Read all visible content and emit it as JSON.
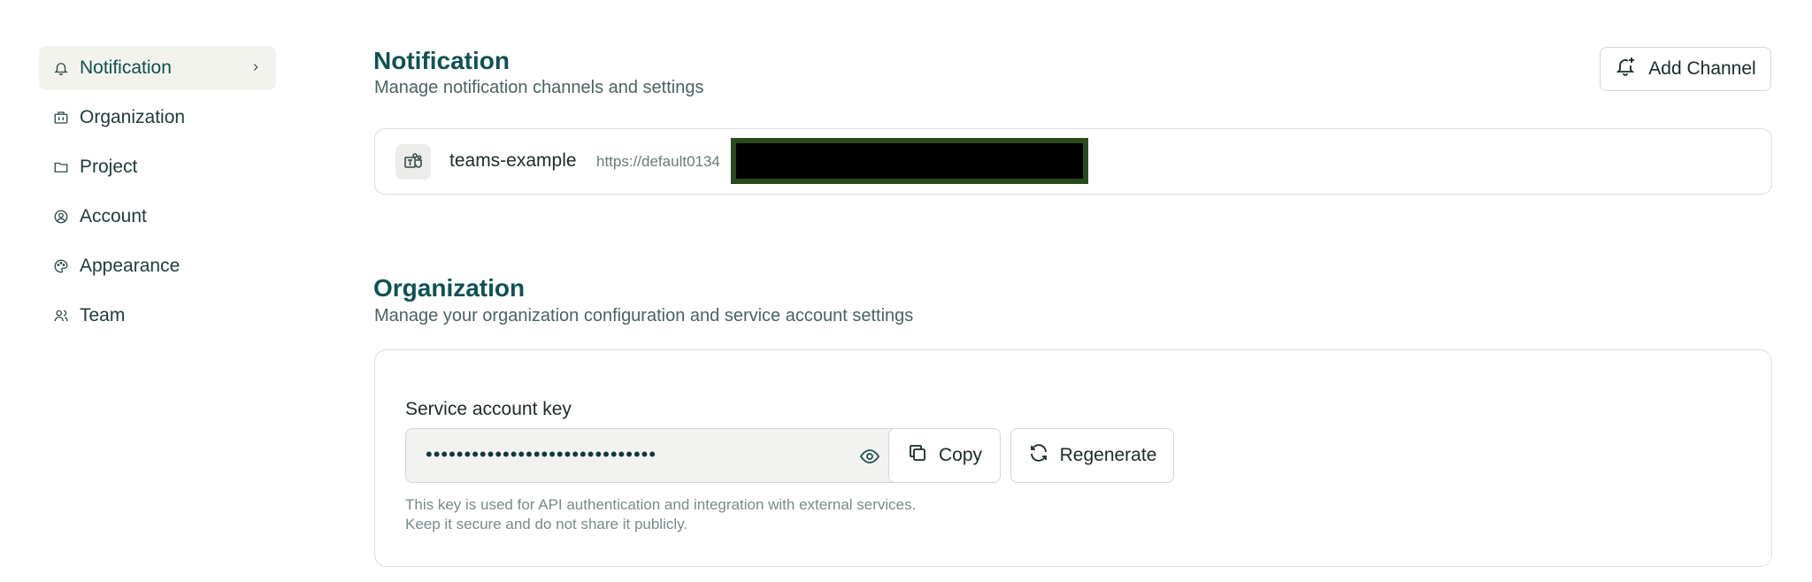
{
  "sidebar": {
    "items": [
      {
        "label": "Notification",
        "icon": "bell-icon",
        "active": true
      },
      {
        "label": "Organization",
        "icon": "building-icon"
      },
      {
        "label": "Project",
        "icon": "folder-icon"
      },
      {
        "label": "Account",
        "icon": "user-circle-icon"
      },
      {
        "label": "Appearance",
        "icon": "palette-icon"
      },
      {
        "label": "Team",
        "icon": "users-icon"
      }
    ]
  },
  "notification": {
    "title": "Notification",
    "subtitle": "Manage notification channels and settings",
    "add_button": "Add Channel",
    "channel": {
      "name": "teams-example",
      "url": "https://default0134"
    }
  },
  "organization": {
    "title": "Organization",
    "subtitle": "Manage your organization configuration and service account settings",
    "key_label": "Service account key",
    "key_value": "••••••••••••••••••••••••••••••",
    "copy_label": "Copy",
    "regenerate_label": "Regenerate",
    "help_line1": "This key is used for API authentication and integration with external services.",
    "help_line2": "Keep it secure and do not share it publicly."
  },
  "colors": {
    "accent": "#0f5252",
    "active_bg": "#f3f3ee",
    "redaction": "#000000"
  }
}
